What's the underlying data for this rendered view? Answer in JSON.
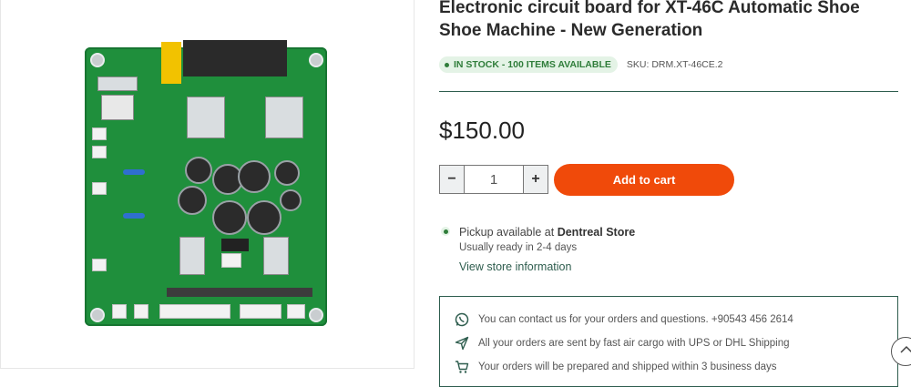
{
  "product": {
    "title": "Electronic circuit board for XT-46C Automatic Shoe Shoe Machine - New Generation",
    "stock_label": "IN STOCK - 100 ITEMS AVAILABLE",
    "sku": "SKU: DRM.XT-46CE.2",
    "price": "$150.00",
    "quantity": "1",
    "add_to_cart": "Add to cart",
    "colors": {
      "accent": "#f04a0a",
      "brand": "#2e5d4e",
      "in_stock": "#2f7d3a"
    }
  },
  "pickup": {
    "prefix": "Pickup available at ",
    "store": "Dentreal Store",
    "ready": "Usually ready in 2-4 days",
    "link": "View store information"
  },
  "info": [
    {
      "icon": "whatsapp-icon",
      "text": "You can contact us for your orders and questions. +90543 456 2614"
    },
    {
      "icon": "send-icon",
      "text": "All your orders are sent by fast air cargo with UPS or DHL Shipping"
    },
    {
      "icon": "cart-icon",
      "text": "Your orders will be prepared and shipped within 3 business days"
    }
  ],
  "controls": {
    "minus": "−",
    "plus": "+"
  }
}
